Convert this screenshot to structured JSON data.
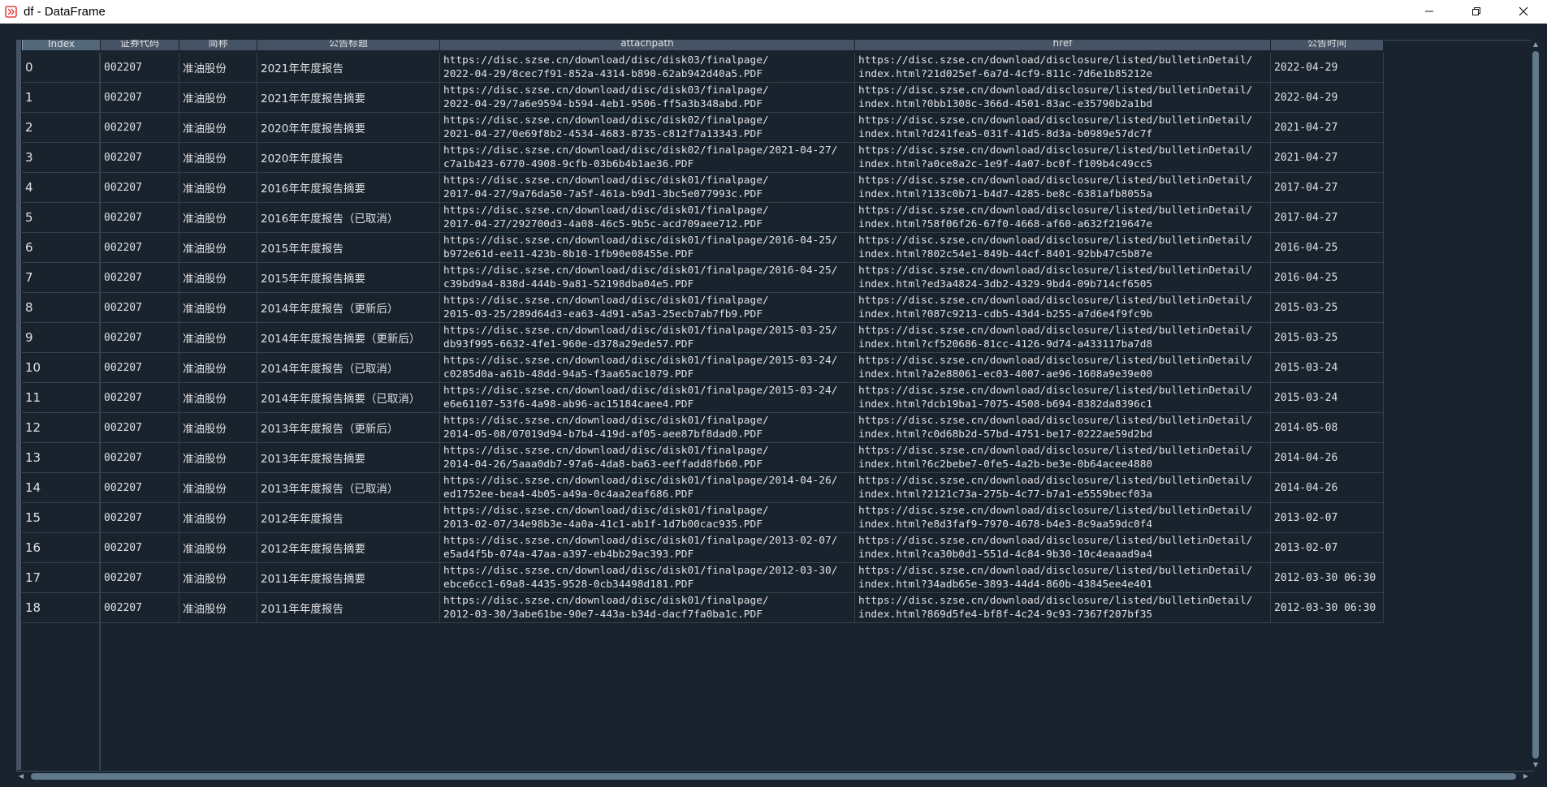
{
  "window": {
    "title": "df - DataFrame",
    "minimize_glyph": "—",
    "restore_glyph": "❐",
    "close_glyph": "✕"
  },
  "table": {
    "columns": [
      "Index",
      "证券代码",
      "简称",
      "公告标题",
      "attachpath",
      "href",
      "公告时间"
    ],
    "rows": [
      {
        "index": "0",
        "code": "002207",
        "name": "准油股份",
        "title": "2021年年度报告",
        "attach": [
          "https://disc.szse.cn/download/disc/disk03/finalpage/",
          "2022-04-29/8cec7f91-852a-4314-b890-62ab942d40a5.PDF"
        ],
        "href": [
          "https://disc.szse.cn/download/disclosure/listed/bulletinDetail/",
          "index.html?21d025ef-6a7d-4cf9-811c-7d6e1b85212e"
        ],
        "date": "2022-04-29"
      },
      {
        "index": "1",
        "code": "002207",
        "name": "准油股份",
        "title": "2021年年度报告摘要",
        "attach": [
          "https://disc.szse.cn/download/disc/disk03/finalpage/",
          "2022-04-29/7a6e9594-b594-4eb1-9506-ff5a3b348abd.PDF"
        ],
        "href": [
          "https://disc.szse.cn/download/disclosure/listed/bulletinDetail/",
          "index.html?0bb1308c-366d-4501-83ac-e35790b2a1bd"
        ],
        "date": "2022-04-29"
      },
      {
        "index": "2",
        "code": "002207",
        "name": "准油股份",
        "title": "2020年年度报告摘要",
        "attach": [
          "https://disc.szse.cn/download/disc/disk02/finalpage/",
          "2021-04-27/0e69f8b2-4534-4683-8735-c812f7a13343.PDF"
        ],
        "href": [
          "https://disc.szse.cn/download/disclosure/listed/bulletinDetail/",
          "index.html?d241fea5-031f-41d5-8d3a-b0989e57dc7f"
        ],
        "date": "2021-04-27"
      },
      {
        "index": "3",
        "code": "002207",
        "name": "准油股份",
        "title": "2020年年度报告",
        "attach": [
          "https://disc.szse.cn/download/disc/disk02/finalpage/2021-04-27/",
          "c7a1b423-6770-4908-9cfb-03b6b4b1ae36.PDF"
        ],
        "href": [
          "https://disc.szse.cn/download/disclosure/listed/bulletinDetail/",
          "index.html?a0ce8a2c-1e9f-4a07-bc0f-f109b4c49cc5"
        ],
        "date": "2021-04-27"
      },
      {
        "index": "4",
        "code": "002207",
        "name": "准油股份",
        "title": "2016年年度报告摘要",
        "attach": [
          "https://disc.szse.cn/download/disc/disk01/finalpage/",
          "2017-04-27/9a76da50-7a5f-461a-b9d1-3bc5e077993c.PDF"
        ],
        "href": [
          "https://disc.szse.cn/download/disclosure/listed/bulletinDetail/",
          "index.html?133c0b71-b4d7-4285-be8c-6381afb8055a"
        ],
        "date": "2017-04-27"
      },
      {
        "index": "5",
        "code": "002207",
        "name": "准油股份",
        "title": "2016年年度报告（已取消）",
        "attach": [
          "https://disc.szse.cn/download/disc/disk01/finalpage/",
          "2017-04-27/292700d3-4a08-46c5-9b5c-acd709aee712.PDF"
        ],
        "href": [
          "https://disc.szse.cn/download/disclosure/listed/bulletinDetail/",
          "index.html?58f06f26-67f0-4668-af60-a632f219647e"
        ],
        "date": "2017-04-27"
      },
      {
        "index": "6",
        "code": "002207",
        "name": "准油股份",
        "title": "2015年年度报告",
        "attach": [
          "https://disc.szse.cn/download/disc/disk01/finalpage/2016-04-25/",
          "b972e61d-ee11-423b-8b10-1fb90e08455e.PDF"
        ],
        "href": [
          "https://disc.szse.cn/download/disclosure/listed/bulletinDetail/",
          "index.html?802c54e1-849b-44cf-8401-92bb47c5b87e"
        ],
        "date": "2016-04-25"
      },
      {
        "index": "7",
        "code": "002207",
        "name": "准油股份",
        "title": "2015年年度报告摘要",
        "attach": [
          "https://disc.szse.cn/download/disc/disk01/finalpage/2016-04-25/",
          "c39bd9a4-838d-444b-9a81-52198dba04e5.PDF"
        ],
        "href": [
          "https://disc.szse.cn/download/disclosure/listed/bulletinDetail/",
          "index.html?ed3a4824-3db2-4329-9bd4-09b714cf6505"
        ],
        "date": "2016-04-25"
      },
      {
        "index": "8",
        "code": "002207",
        "name": "准油股份",
        "title": "2014年年度报告（更新后）",
        "attach": [
          "https://disc.szse.cn/download/disc/disk01/finalpage/",
          "2015-03-25/289d64d3-ea63-4d91-a5a3-25ecb7ab7fb9.PDF"
        ],
        "href": [
          "https://disc.szse.cn/download/disclosure/listed/bulletinDetail/",
          "index.html?087c9213-cdb5-43d4-b255-a7d6e4f9fc9b"
        ],
        "date": "2015-03-25"
      },
      {
        "index": "9",
        "code": "002207",
        "name": "准油股份",
        "title": "2014年年度报告摘要（更新后）",
        "attach": [
          "https://disc.szse.cn/download/disc/disk01/finalpage/2015-03-25/",
          "db93f995-6632-4fe1-960e-d378a29ede57.PDF"
        ],
        "href": [
          "https://disc.szse.cn/download/disclosure/listed/bulletinDetail/",
          "index.html?cf520686-81cc-4126-9d74-a433117ba7d8"
        ],
        "date": "2015-03-25"
      },
      {
        "index": "10",
        "code": "002207",
        "name": "准油股份",
        "title": "2014年年度报告（已取消）",
        "attach": [
          "https://disc.szse.cn/download/disc/disk01/finalpage/2015-03-24/",
          "c0285d0a-a61b-48dd-94a5-f3aa65ac1079.PDF"
        ],
        "href": [
          "https://disc.szse.cn/download/disclosure/listed/bulletinDetail/",
          "index.html?a2e88061-ec03-4007-ae96-1608a9e39e00"
        ],
        "date": "2015-03-24"
      },
      {
        "index": "11",
        "code": "002207",
        "name": "准油股份",
        "title": "2014年年度报告摘要（已取消）",
        "attach": [
          "https://disc.szse.cn/download/disc/disk01/finalpage/2015-03-24/",
          "e6e61107-53f6-4a98-ab96-ac15184caee4.PDF"
        ],
        "href": [
          "https://disc.szse.cn/download/disclosure/listed/bulletinDetail/",
          "index.html?dcb19ba1-7075-4508-b694-8382da8396c1"
        ],
        "date": "2015-03-24"
      },
      {
        "index": "12",
        "code": "002207",
        "name": "准油股份",
        "title": "2013年年度报告（更新后）",
        "attach": [
          "https://disc.szse.cn/download/disc/disk01/finalpage/",
          "2014-05-08/07019d94-b7b4-419d-af05-aee87bf8dad0.PDF"
        ],
        "href": [
          "https://disc.szse.cn/download/disclosure/listed/bulletinDetail/",
          "index.html?c0d68b2d-57bd-4751-be17-0222ae59d2bd"
        ],
        "date": "2014-05-08"
      },
      {
        "index": "13",
        "code": "002207",
        "name": "准油股份",
        "title": "2013年年度报告摘要",
        "attach": [
          "https://disc.szse.cn/download/disc/disk01/finalpage/",
          "2014-04-26/5aaa0db7-97a6-4da8-ba63-eeffadd8fb60.PDF"
        ],
        "href": [
          "https://disc.szse.cn/download/disclosure/listed/bulletinDetail/",
          "index.html?6c2bebe7-0fe5-4a2b-be3e-0b64acee4880"
        ],
        "date": "2014-04-26"
      },
      {
        "index": "14",
        "code": "002207",
        "name": "准油股份",
        "title": "2013年年度报告（已取消）",
        "attach": [
          "https://disc.szse.cn/download/disc/disk01/finalpage/2014-04-26/",
          "ed1752ee-bea4-4b05-a49a-0c4aa2eaf686.PDF"
        ],
        "href": [
          "https://disc.szse.cn/download/disclosure/listed/bulletinDetail/",
          "index.html?2121c73a-275b-4c77-b7a1-e5559becf03a"
        ],
        "date": "2014-04-26"
      },
      {
        "index": "15",
        "code": "002207",
        "name": "准油股份",
        "title": "2012年年度报告",
        "attach": [
          "https://disc.szse.cn/download/disc/disk01/finalpage/",
          "2013-02-07/34e98b3e-4a0a-41c1-ab1f-1d7b00cac935.PDF"
        ],
        "href": [
          "https://disc.szse.cn/download/disclosure/listed/bulletinDetail/",
          "index.html?e8d3faf9-7970-4678-b4e3-8c9aa59dc0f4"
        ],
        "date": "2013-02-07"
      },
      {
        "index": "16",
        "code": "002207",
        "name": "准油股份",
        "title": "2012年年度报告摘要",
        "attach": [
          "https://disc.szse.cn/download/disc/disk01/finalpage/2013-02-07/",
          "e5ad4f5b-074a-47aa-a397-eb4bb29ac393.PDF"
        ],
        "href": [
          "https://disc.szse.cn/download/disclosure/listed/bulletinDetail/",
          "index.html?ca30b0d1-551d-4c84-9b30-10c4eaaad9a4"
        ],
        "date": "2013-02-07"
      },
      {
        "index": "17",
        "code": "002207",
        "name": "准油股份",
        "title": "2011年年度报告摘要",
        "attach": [
          "https://disc.szse.cn/download/disc/disk01/finalpage/2012-03-30/",
          "ebce6cc1-69a8-4435-9528-0cb34498d181.PDF"
        ],
        "href": [
          "https://disc.szse.cn/download/disclosure/listed/bulletinDetail/",
          "index.html?34adb65e-3893-44d4-860b-43845ee4e401"
        ],
        "date": "2012-03-30 06:30"
      },
      {
        "index": "18",
        "code": "002207",
        "name": "准油股份",
        "title": "2011年年度报告",
        "attach": [
          "https://disc.szse.cn/download/disc/disk01/finalpage/",
          "2012-03-30/3abe61be-90e7-443a-b34d-dacf7fa0ba1c.PDF"
        ],
        "href": [
          "https://disc.szse.cn/download/disclosure/listed/bulletinDetail/",
          "index.html?869d5fe4-bf8f-4c24-9c93-7367f207bf35"
        ],
        "date": "2012-03-30 06:30"
      }
    ]
  },
  "colors": {
    "background": "#19232d",
    "header": "#455364",
    "grid": "#32414b",
    "text": "#e0e1e3",
    "scroll_thumb": "#60798b",
    "app_icon": "#e0443c"
  },
  "icons": {
    "app": "dataframe-app-icon",
    "minimize": "minimize-icon",
    "restore": "restore-icon",
    "close": "close-icon"
  }
}
